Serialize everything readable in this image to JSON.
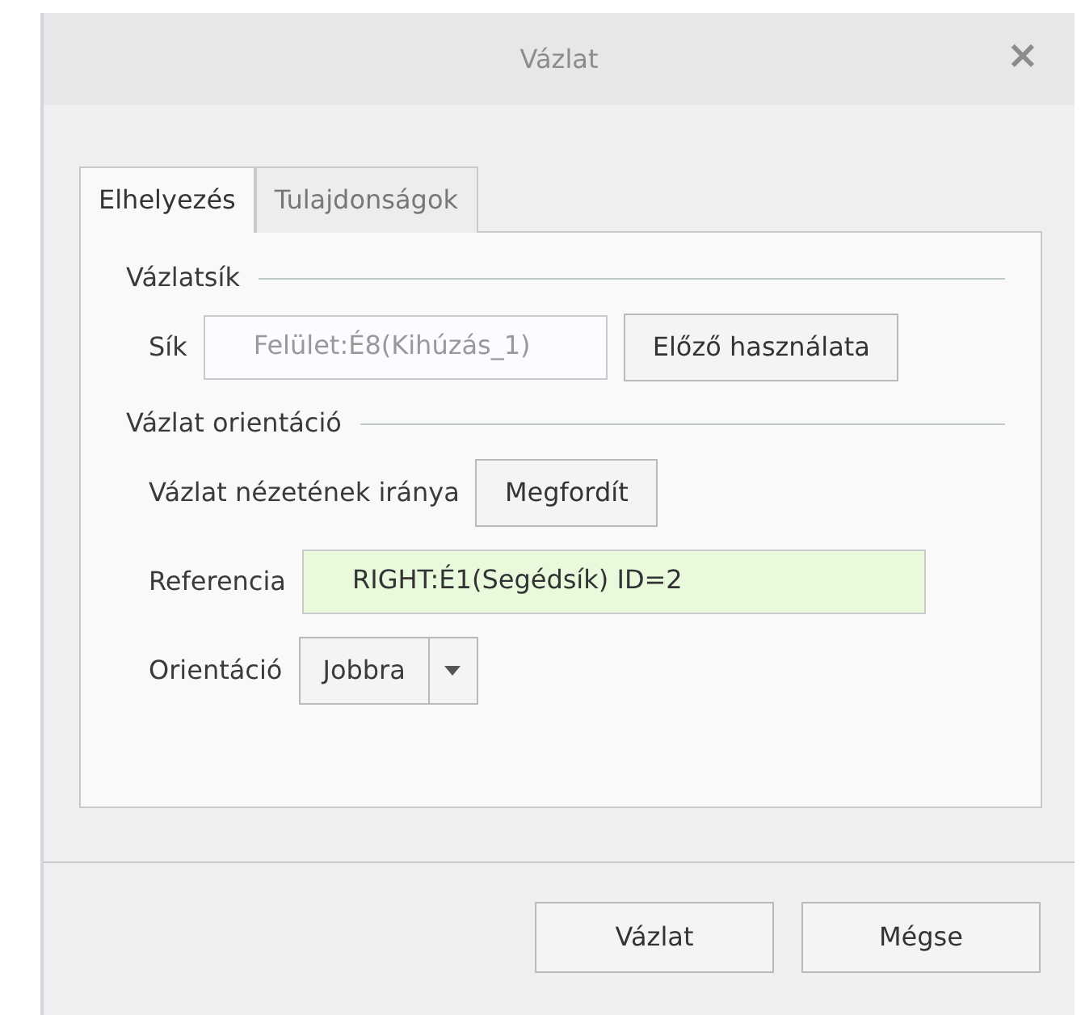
{
  "window": {
    "title": "Vázlat",
    "close": "×"
  },
  "tabs": [
    {
      "label": "Elhelyezés",
      "selected": true
    },
    {
      "label": "Tulajdonságok",
      "selected": false
    }
  ],
  "sections": [
    {
      "title": "Vázlatsík",
      "rows": [
        {
          "kind": "field",
          "label": "Sík",
          "value": "Felület:É8(Kihúzás_1)",
          "highlighted": false,
          "button": "Előző használata"
        }
      ]
    },
    {
      "title": "Vázlat orientáció",
      "rows": [
        {
          "kind": "button",
          "label": "Vázlat nézetének iránya",
          "button": "Megfordít"
        },
        {
          "kind": "field",
          "label": "Referencia",
          "value": "RIGHT:É1(Segédsík) ID=2",
          "highlighted": true
        },
        {
          "kind": "dropdown",
          "label": "Orientáció",
          "value": "Jobbra"
        }
      ]
    }
  ],
  "buttons": [
    "Vázlat",
    "Mégse"
  ]
}
